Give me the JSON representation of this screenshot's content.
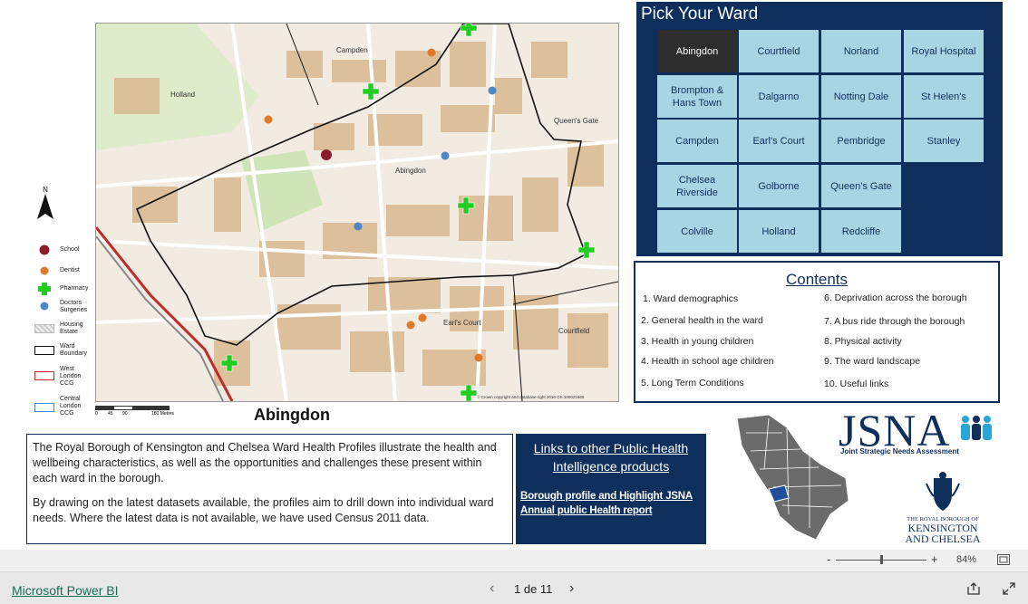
{
  "map": {
    "labels": {
      "campden": "Campden",
      "holland": "Holland",
      "abingdon": "Abingdon",
      "queens_gate": "Queen's Gate",
      "earls_court": "Earl's Court",
      "courtfield": "Courtfield",
      "copyright": "© Crown copyright and database right 2016 OS 100021668"
    },
    "north": "N",
    "scale": [
      "0",
      "45",
      "90",
      "180 Metres"
    ],
    "legend": [
      "School",
      "Dentist",
      "Pharmacy",
      "Doctors Surgeries",
      "Housing Estate",
      "Ward Boundary",
      "West London CCG",
      "Central London CCG"
    ],
    "ward_title": "Abingdon"
  },
  "picker": {
    "title": "Pick Your Ward",
    "selected": "Abingdon",
    "wards": [
      [
        "Abingdon",
        "Courtfield",
        "Norland",
        "Royal Hospital"
      ],
      [
        "Brompton & Hans Town",
        "Dalgarno",
        "Notting Dale",
        "St Helen's"
      ],
      [
        "Campden",
        "Earl's Court",
        "Pembridge",
        "Stanley"
      ],
      [
        "Chelsea Riverside",
        "Golborne",
        "Queen's Gate"
      ],
      [
        "Colville",
        "Holland",
        "Redcliffe"
      ]
    ]
  },
  "contents": {
    "title": "Contents",
    "left": [
      "1. Ward demographics",
      "2. General health in the ward",
      "3. Health in young children",
      "4. Health in school age children",
      "5. Long Term Conditions"
    ],
    "right": [
      "6. Deprivation across the borough",
      "7. A bus ride through the borough",
      "8. Physical activity",
      "9. The ward landscape",
      "10. Useful links"
    ]
  },
  "description": {
    "p1": "The Royal Borough of Kensington and Chelsea Ward Health Profiles illustrate the health and wellbeing characteristics, as well as the opportunities and challenges these present within each ward in the borough.",
    "p2": "By drawing on the latest datasets available, the profiles aim to drill down into individual ward needs. Where the latest data is not available, we have used Census 2011 data."
  },
  "links": {
    "title": "Links to other Public Health Intelligence products",
    "items": [
      "Borough profile and Highlight JSNA",
      "Annual public Health report"
    ]
  },
  "logos": {
    "jsna": "JSNA",
    "jsna_sub": "Joint Strategic Needs Assessment",
    "rbkc_small": "THE ROYAL BOROUGH OF",
    "rbkc_line1": "KENSINGTON",
    "rbkc_line2": "AND CHELSEA"
  },
  "zoom": {
    "percent": "84%",
    "minus": "-",
    "plus": "+",
    "level": 0.5
  },
  "statusbar": {
    "app_link": "Microsoft Power BI",
    "page": "1 de 11"
  },
  "colors": {
    "navy": "#0e2f5b",
    "tile": "#a8d5e4",
    "selected": "#2d2d2d",
    "pharmacy": "#22cc22",
    "dentist": "#e07a2a",
    "doctor": "#4a88c7"
  }
}
